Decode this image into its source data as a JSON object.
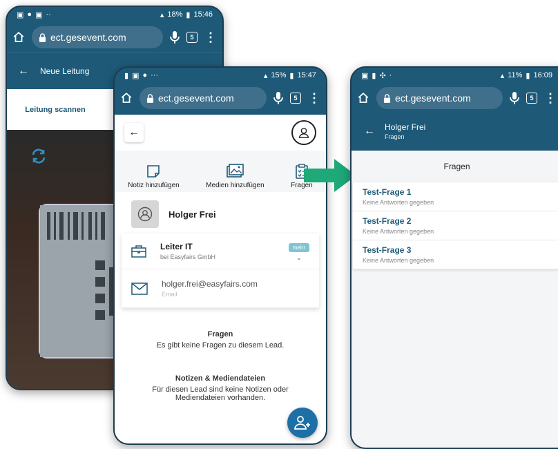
{
  "phone1": {
    "status_time": "15:46",
    "status_battery": "18%",
    "url": "ect.gesevent.com",
    "tab_count": "5",
    "appbar_title": "Neue Leitung",
    "tab_label": "Leitung scannen"
  },
  "phone2": {
    "status_time": "15:47",
    "status_battery": "15%",
    "url": "ect.gesevent.com",
    "tab_count": "5",
    "actions": {
      "note": "Notiz hinzufügen",
      "media": "Medien hinzufügen",
      "questions": "Fragen"
    },
    "contact": {
      "name": "Holger Frei",
      "position": "Leiter IT",
      "company": "bei Easyfairs GmbH",
      "more_label": "mehr",
      "email": "holger.frei@easyfairs.com",
      "email_label": "Email"
    },
    "questions_section": {
      "heading": "Fragen",
      "text": "Es gibt keine Fragen zu diesem Lead."
    },
    "notes_section": {
      "heading": "Notizen & Mediendateien",
      "text": "Für diesen Lead sind keine Notizen oder Mediendateien vorhanden."
    }
  },
  "phone3": {
    "status_time": "16:09",
    "status_battery": "11%",
    "url": "ect.gesevent.com",
    "tab_count": "5",
    "appbar_title": "Holger Frei",
    "appbar_subtitle": "Fragen",
    "section_header": "Fragen",
    "questions": [
      {
        "title": "Test-Frage 1",
        "status": "Keine Antworten gegeben"
      },
      {
        "title": "Test-Frage 2",
        "status": "Keine Antworten gegeben"
      },
      {
        "title": "Test-Frage 3",
        "status": "Keine Antworten gegeben"
      }
    ]
  },
  "colors": {
    "brand": "#1e5a78",
    "arrow": "#1fa878",
    "fab": "#1e6fa6",
    "mehr_badge": "#7ec5cf"
  }
}
